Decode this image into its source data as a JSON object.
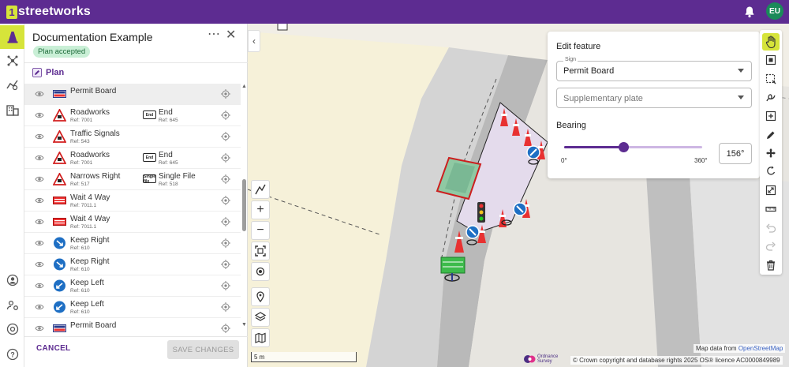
{
  "app": {
    "logo_mark": "1",
    "logo_text": "streetworks",
    "user_initials": "EU"
  },
  "rail": {
    "items": [
      "cone-icon",
      "network-icon",
      "analytics-icon",
      "building-icon",
      "account-icon",
      "team-icon",
      "support-icon",
      "help-icon"
    ]
  },
  "panel": {
    "title": "Documentation Example",
    "status": "Plan accepted",
    "plan_label": "Plan",
    "items": [
      {
        "name": "Permit Board",
        "ref": "",
        "icon": "permit-board",
        "sel": true
      },
      {
        "name": "Roadworks",
        "ref": "Ref: 7001",
        "icon": "warn-roadworks",
        "secondary": {
          "icon": "End",
          "name": "End",
          "ref": "Ref: 645"
        }
      },
      {
        "name": "Traffic Signals",
        "ref": "Ref: 543",
        "icon": "warn-signals"
      },
      {
        "name": "Roadworks",
        "ref": "Ref: 7001",
        "icon": "warn-roadworks",
        "secondary": {
          "icon": "End",
          "name": "End",
          "ref": "Ref: 645"
        }
      },
      {
        "name": "Narrows Right",
        "ref": "Ref: 517",
        "icon": "warn-narrows",
        "secondary": {
          "icon": "Single file",
          "name": "Single File",
          "ref": "Ref: 518"
        }
      },
      {
        "name": "Wait 4 Way",
        "ref": "Ref: 7011.1",
        "icon": "wait-board"
      },
      {
        "name": "Wait 4 Way",
        "ref": "Ref: 7011.1",
        "icon": "wait-board"
      },
      {
        "name": "Keep Right",
        "ref": "Ref: 610",
        "icon": "keep-right"
      },
      {
        "name": "Keep Right",
        "ref": "Ref: 610",
        "icon": "keep-right"
      },
      {
        "name": "Keep Left",
        "ref": "Ref: 610",
        "icon": "keep-left"
      },
      {
        "name": "Keep Left",
        "ref": "Ref: 610",
        "icon": "keep-left"
      },
      {
        "name": "Permit Board",
        "ref": "",
        "icon": "permit-board"
      }
    ],
    "cancel_label": "CANCEL",
    "save_label": "SAVE CHANGES"
  },
  "map": {
    "scale": "5 m",
    "attribution_prefix": "Map data from ",
    "attribution_link": "OpenStreetMap",
    "copyright": "© Crown copyright and database rights 2025 OS® licence AC0000849989",
    "os_logo_text": [
      "Ordnance",
      "Survey"
    ]
  },
  "edit_feature": {
    "title": "Edit feature",
    "sign_label": "Sign",
    "sign_value": "Permit Board",
    "supplementary_placeholder": "Supplementary plate",
    "bearing_label": "Bearing",
    "bearing_min": "0°",
    "bearing_max": "360°",
    "bearing_value": "156°",
    "bearing_fraction": 0.433
  },
  "colors": {
    "brand": "#5d2c91",
    "accent": "#d6e43a",
    "avatar": "#1a8a5a"
  }
}
